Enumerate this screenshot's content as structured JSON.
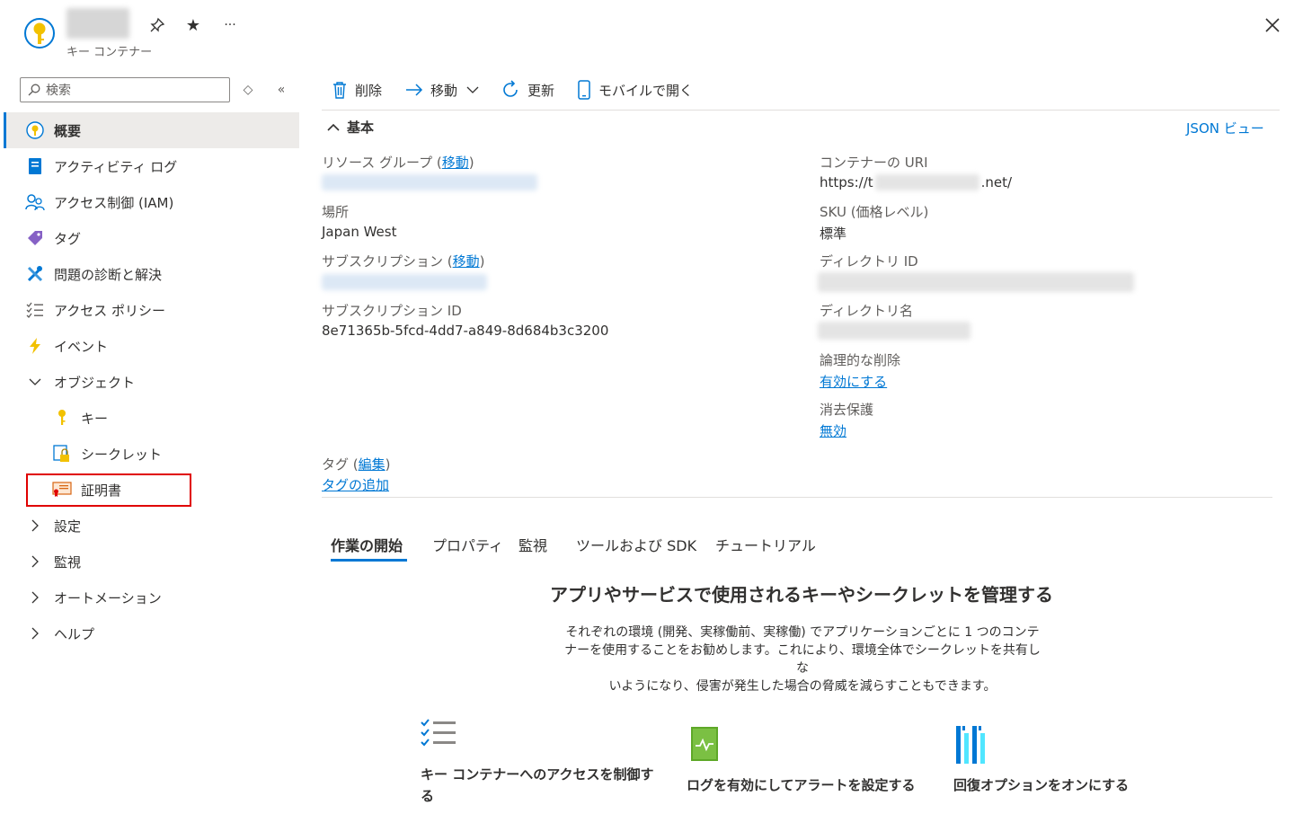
{
  "header": {
    "resource_type": "キー コンテナー",
    "more_label": "···"
  },
  "nav": {
    "search_placeholder": "検索",
    "items": [
      {
        "label": "概要"
      },
      {
        "label": "アクティビティ ログ"
      },
      {
        "label": "アクセス制御 (IAM)"
      },
      {
        "label": "タグ"
      },
      {
        "label": "問題の診断と解決"
      },
      {
        "label": "アクセス ポリシー"
      },
      {
        "label": "イベント"
      },
      {
        "label": "オブジェクト"
      },
      {
        "label": "キー"
      },
      {
        "label": "シークレット"
      },
      {
        "label": "証明書"
      },
      {
        "label": "設定"
      },
      {
        "label": "監視"
      },
      {
        "label": "オートメーション"
      },
      {
        "label": "ヘルプ"
      }
    ]
  },
  "toolbar": {
    "delete": "削除",
    "move": "移動",
    "refresh": "更新",
    "open_mobile": "モバイルで開く"
  },
  "essentials": {
    "title": "基本",
    "json_view": "JSON ビュー",
    "resource_group_label": "リソース グループ (",
    "resource_group_link": "移動",
    "close_paren": ")",
    "location_label": "場所",
    "location_value": "Japan West",
    "subscription_label": "サブスクリプション (",
    "subscription_link": "移動",
    "subscription_id_label": "サブスクリプション ID",
    "subscription_id_value": "8e71365b-5fcd-4dd7-a849-8d684b3c3200",
    "vault_uri_label": "コンテナーの URI",
    "vault_uri_prefix": "https://t",
    "vault_uri_suffix": ".net/",
    "sku_label": "SKU (価格レベル)",
    "sku_value": "標準",
    "directory_id_label": "ディレクトリ ID",
    "directory_name_label": "ディレクトリ名",
    "soft_delete_label": "論理的な削除",
    "soft_delete_value": "有効にする",
    "purge_label": "消去保護",
    "purge_value": "無効",
    "tags_label": "タグ (",
    "tags_edit": "編集",
    "tags_add": "タグの追加"
  },
  "tabs": [
    "作業の開始",
    "プロパティ",
    "監視",
    "ツールおよび SDK",
    "チュートリアル"
  ],
  "hero": {
    "title": "アプリやサービスで使用されるキーやシークレットを管理する",
    "desc_line1": "それぞれの環境 (開発、実稼働前、実稼働) でアプリケーションごとに 1 つのコンテ",
    "desc_line2": "ナーを使用することをお勧めします。これにより、環境全体でシークレットを共有しな",
    "desc_line3": "いようになり、侵害が発生した場合の脅威を減らすこともできます。"
  },
  "cards": [
    {
      "line1": "キー コンテナーへのアクセスを制御す",
      "line2": "る"
    },
    {
      "line1": "ログを有効にしてアラートを設定する"
    },
    {
      "line1": "回復オプションをオンにする"
    }
  ],
  "colors": {
    "accent": "#0078d4",
    "highlight": "#e00000"
  }
}
